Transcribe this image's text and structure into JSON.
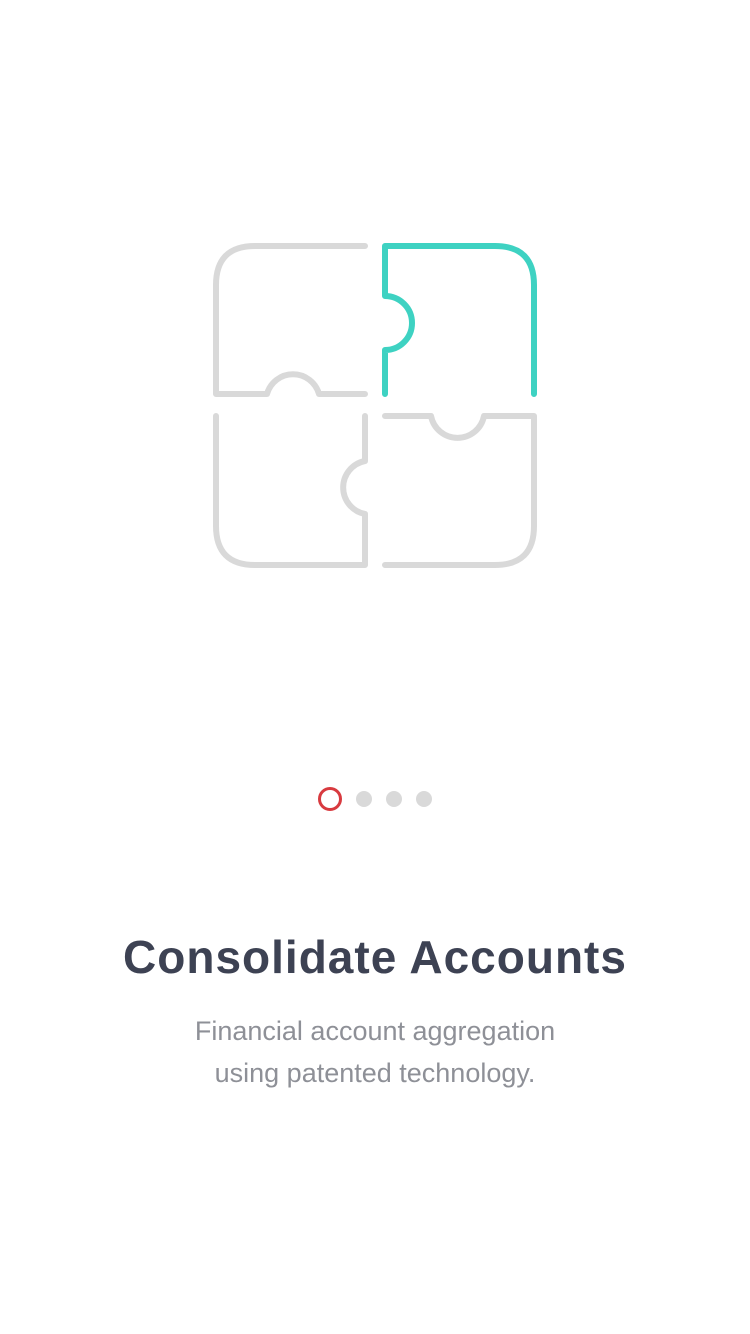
{
  "colors": {
    "background": "#ffffff",
    "accent_teal": "#3ed2c2",
    "inactive_gray": "#d9d9d9",
    "active_dot_red": "#d83a3f",
    "title_text": "#3d4253",
    "subtitle_text": "#8e9097"
  },
  "illustration": {
    "icon": "puzzle-icon",
    "highlighted_piece": "top-right"
  },
  "pager": {
    "total": 4,
    "active_index": 0
  },
  "onboarding": {
    "title": "Consolidate Accounts",
    "subtitle_line1": "Financial account aggregation",
    "subtitle_line2": "using patented technology."
  }
}
